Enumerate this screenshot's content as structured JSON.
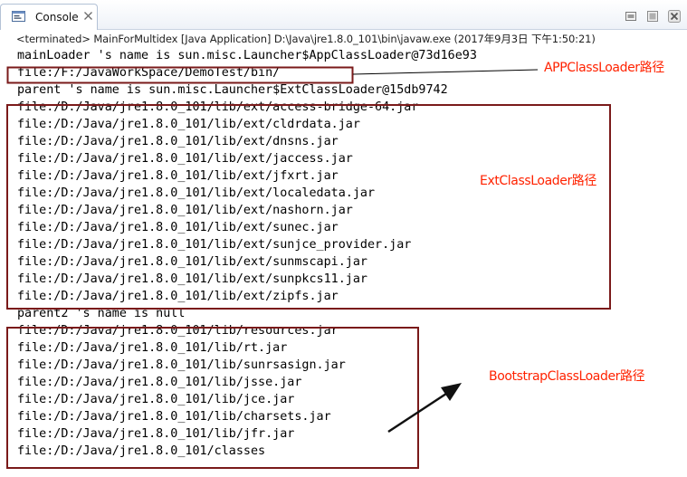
{
  "tab": {
    "icon": "console-icon",
    "label": "Console",
    "close_icon": "close-icon"
  },
  "window_controls": [
    "clear-console-icon",
    "remove-launch-icon",
    "remove-all-launches-icon"
  ],
  "status": "<terminated> MainForMultidex [Java Application] D:\\Java\\jre1.8.0_101\\bin\\javaw.exe (2017年9月3日 下午1:50:21)",
  "console_lines": [
    "mainLoader 's name is sun.misc.Launcher$AppClassLoader@73d16e93",
    "file:/F:/JavaWorkSpace/DemoTest/bin/",
    "parent 's name is sun.misc.Launcher$ExtClassLoader@15db9742",
    "file:/D:/Java/jre1.8.0_101/lib/ext/access-bridge-64.jar",
    "file:/D:/Java/jre1.8.0_101/lib/ext/cldrdata.jar",
    "file:/D:/Java/jre1.8.0_101/lib/ext/dnsns.jar",
    "file:/D:/Java/jre1.8.0_101/lib/ext/jaccess.jar",
    "file:/D:/Java/jre1.8.0_101/lib/ext/jfxrt.jar",
    "file:/D:/Java/jre1.8.0_101/lib/ext/localedata.jar",
    "file:/D:/Java/jre1.8.0_101/lib/ext/nashorn.jar",
    "file:/D:/Java/jre1.8.0_101/lib/ext/sunec.jar",
    "file:/D:/Java/jre1.8.0_101/lib/ext/sunjce_provider.jar",
    "file:/D:/Java/jre1.8.0_101/lib/ext/sunmscapi.jar",
    "file:/D:/Java/jre1.8.0_101/lib/ext/sunpkcs11.jar",
    "file:/D:/Java/jre1.8.0_101/lib/ext/zipfs.jar",
    "parent2 's name is null",
    "file:/D:/Java/jre1.8.0_101/lib/resources.jar",
    "file:/D:/Java/jre1.8.0_101/lib/rt.jar",
    "file:/D:/Java/jre1.8.0_101/lib/sunrsasign.jar",
    "file:/D:/Java/jre1.8.0_101/lib/jsse.jar",
    "file:/D:/Java/jre1.8.0_101/lib/jce.jar",
    "file:/D:/Java/jre1.8.0_101/lib/charsets.jar",
    "file:/D:/Java/jre1.8.0_101/lib/jfr.jar",
    "file:/D:/Java/jre1.8.0_101/classes"
  ],
  "annotations": {
    "app_label": "APPClassLoader路径",
    "ext_label": "ExtClassLoader路径",
    "bootstrap_label": "BootstrapClassLoader路径",
    "box_color": "#7a1a1a",
    "label_color": "#ff2200",
    "arrow_color": "#000000"
  },
  "colors": {
    "tab_border": "#b4c2d6",
    "toolbar_bg": "#eef2f8",
    "text": "#000000"
  }
}
